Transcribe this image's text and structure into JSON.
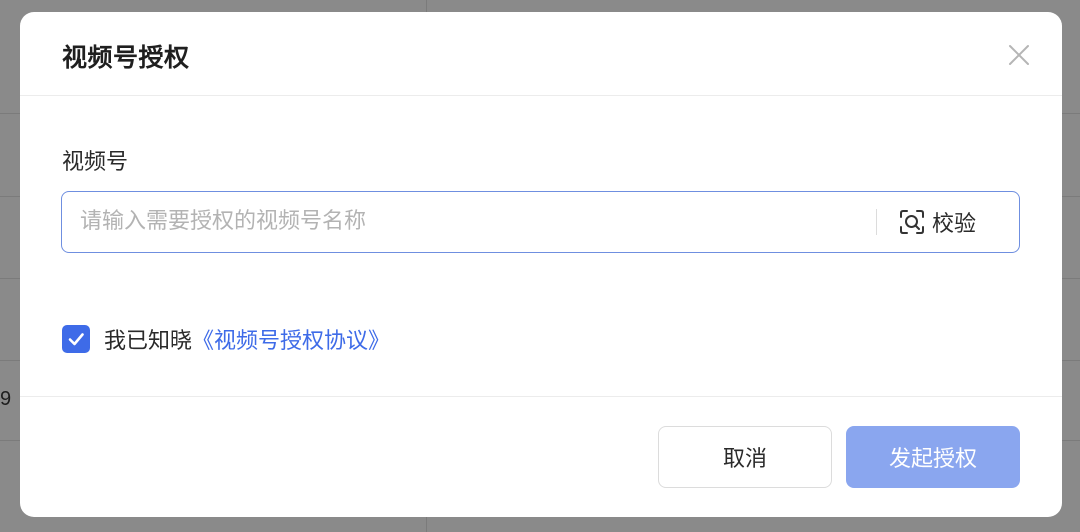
{
  "background": {
    "partial_cell_text": "9"
  },
  "modal": {
    "title": "视频号授权",
    "close_icon": "close-icon",
    "field_label": "视频号",
    "input": {
      "value": "",
      "placeholder": "请输入需要授权的视频号名称"
    },
    "verify": {
      "icon": "scan-icon",
      "label": "校验"
    },
    "agreement": {
      "checked": true,
      "text": "我已知晓",
      "link": "《视频号授权协议》"
    },
    "buttons": {
      "cancel": "取消",
      "submit": "发起授权"
    }
  },
  "colors": {
    "accent": "#3e6be8",
    "primary_disabled": "#8aa6ef",
    "input_border": "#6f8fe0",
    "overlay": "#8a8a8a"
  }
}
